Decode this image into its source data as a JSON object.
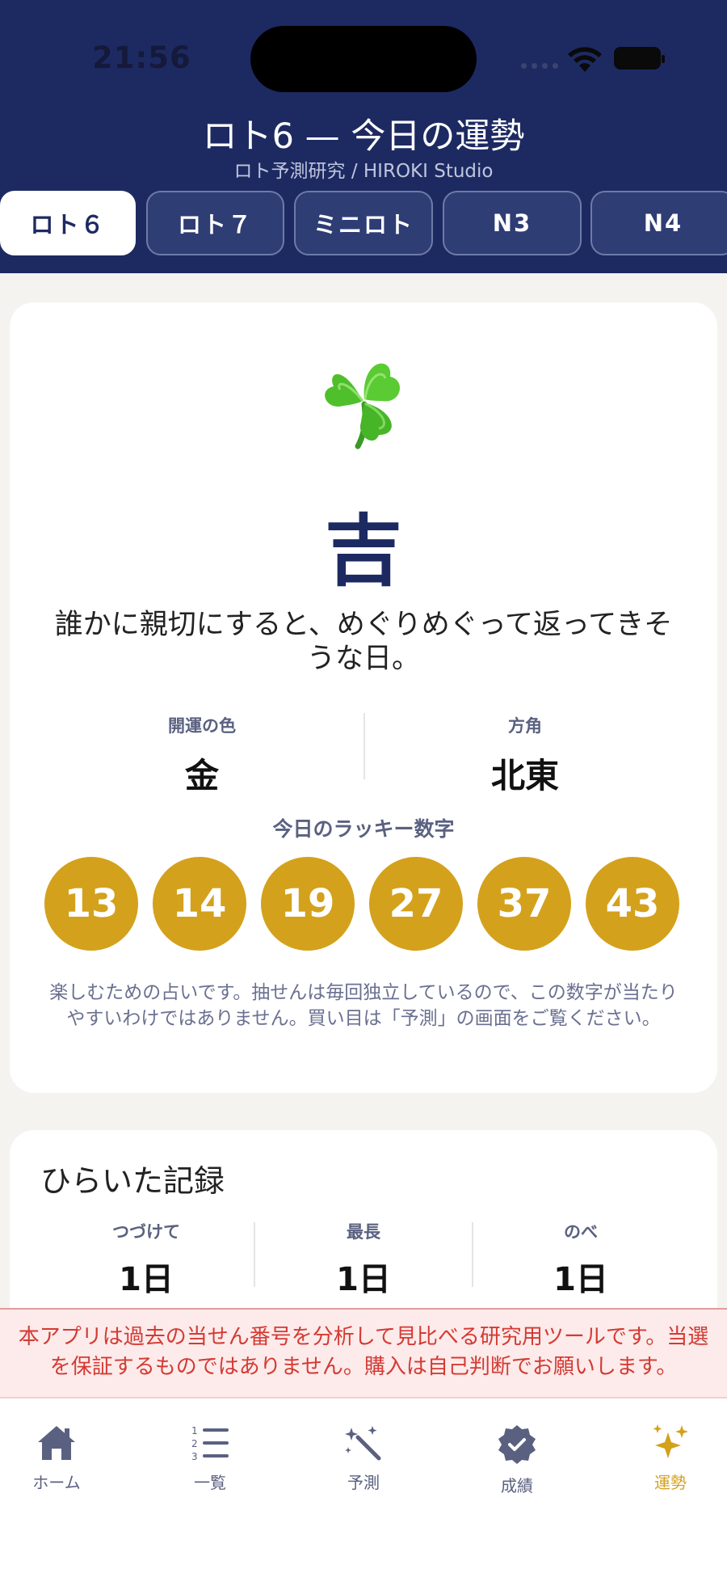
{
  "status_bar": {
    "time": "21:56"
  },
  "header": {
    "title": "ロト6 — 今日の運勢",
    "subtitle": "ロト予測研究 / HIROKI Studio"
  },
  "tabs": [
    {
      "label": "ロト６",
      "active": true
    },
    {
      "label": "ロト７",
      "active": false
    },
    {
      "label": "ミニロト",
      "active": false
    },
    {
      "label": "N3",
      "active": false
    },
    {
      "label": "N4",
      "active": false
    }
  ],
  "fortune": {
    "icon": "four-leaf-clover",
    "result": "吉",
    "message": "誰かに親切にすると、めぐりめぐって返ってきそうな日。",
    "lucky_color_label": "開運の色",
    "lucky_color": "金",
    "direction_label": "方角",
    "direction": "北東",
    "lucky_numbers_title": "今日のラッキー数字",
    "lucky_numbers": [
      "13",
      "14",
      "19",
      "27",
      "37",
      "43"
    ],
    "note": "楽しむための占いです。抽せんは毎回独立しているので、この数字が当たりやすいわけではありません。買い目は「予測」の画面をご覧ください。"
  },
  "record": {
    "title": "ひらいた記録",
    "stats": [
      {
        "label": "つづけて",
        "value": "1日"
      },
      {
        "label": "最長",
        "value": "1日"
      },
      {
        "label": "のべ",
        "value": "1日"
      }
    ]
  },
  "disclaimer": "本アプリは過去の当せん番号を分析して見比べる研究用ツールです。当選を保証するものではありません。購入は自己判断でお願いします。",
  "nav": [
    {
      "label": "ホーム",
      "icon": "house-icon",
      "active": false
    },
    {
      "label": "一覧",
      "icon": "numbered-list-icon",
      "active": false
    },
    {
      "label": "予測",
      "icon": "magic-wand-icon",
      "active": false
    },
    {
      "label": "成績",
      "icon": "verified-badge-icon",
      "active": false
    },
    {
      "label": "運勢",
      "icon": "sparkles-icon",
      "active": true
    }
  ],
  "colors": {
    "header_bg": "#1d2a62",
    "accent_gold": "#d4a11c",
    "warning_red": "#d43a34"
  }
}
